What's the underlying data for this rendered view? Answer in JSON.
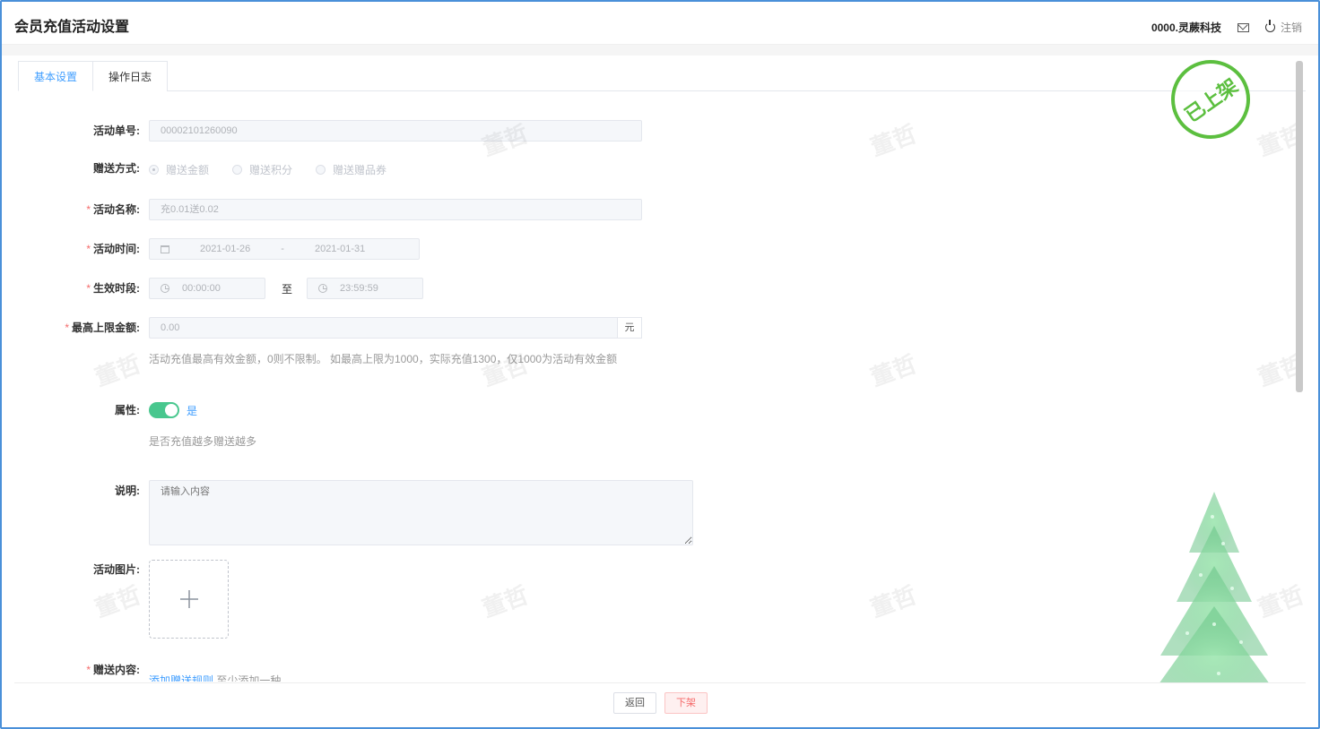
{
  "header": {
    "title": "会员充值活动设置",
    "company": "0000.灵蕨科技",
    "logout_label": "注销"
  },
  "tabs": [
    {
      "label": "基本设置",
      "active": true
    },
    {
      "label": "操作日志",
      "active": false
    }
  ],
  "stamp_text": "已上架",
  "watermark_text": "董哲",
  "form": {
    "activity_no": {
      "label": "活动单号:",
      "value": "00002101260090"
    },
    "gift_method": {
      "label": "赠送方式:",
      "options": [
        "赠送金额",
        "赠送积分",
        "赠送赠品券"
      ],
      "selected": "赠送金额"
    },
    "activity_name": {
      "label": "活动名称:",
      "value": "充0.01送0.02"
    },
    "activity_time": {
      "label": "活动时间:",
      "start": "2021-01-26",
      "separator": "-",
      "end": "2021-01-31"
    },
    "effective_period": {
      "label": "生效时段:",
      "start": "00:00:00",
      "to": "至",
      "end": "23:59:59"
    },
    "max_amount": {
      "label": "最高上限金额:",
      "value": "0.00",
      "unit": "元",
      "hint": "活动充值最高有效金额，0则不限制。 如最高上限为1000，实际充值1300，仅1000为活动有效金额"
    },
    "attribute": {
      "label": "属性:",
      "toggle_on": true,
      "toggle_label": "是",
      "hint": "是否充值越多赠送越多"
    },
    "description": {
      "label": "说明:",
      "placeholder": "请输入内容"
    },
    "activity_image": {
      "label": "活动图片:"
    },
    "gift_content": {
      "label": "赠送内容:",
      "link": "添加赠送规则",
      "hint": "至少添加一种"
    }
  },
  "footer": {
    "back_label": "返回",
    "offshelf_label": "下架"
  },
  "colors": {
    "primary": "#409eff",
    "required": "#f56c6c",
    "toggle": "#48c78e",
    "stamp": "#5cbf3f"
  }
}
